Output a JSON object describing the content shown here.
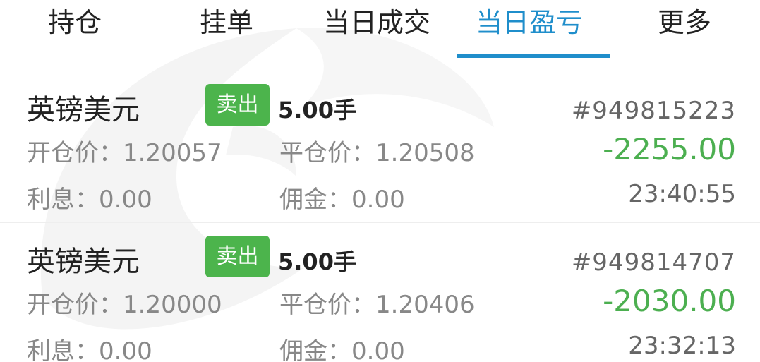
{
  "tabs": [
    {
      "label": "持仓"
    },
    {
      "label": "挂单"
    },
    {
      "label": "当日成交"
    },
    {
      "label": "当日盈亏"
    },
    {
      "label": "更多"
    }
  ],
  "active_tab": "当日盈亏",
  "labels": {
    "open_price": "开仓价：",
    "close_price": "平仓价：",
    "swap": "利息：",
    "commission": "佣金："
  },
  "orders": [
    {
      "symbol": "英镑美元",
      "side": "卖出",
      "lots": "5.00手",
      "order_id": "#949815223",
      "open_price": "1.20057",
      "close_price": "1.20508",
      "profit": "-2255.00",
      "swap": "0.00",
      "commission": "0.00",
      "time": "23:40:55"
    },
    {
      "symbol": "英镑美元",
      "side": "卖出",
      "lots": "5.00手",
      "order_id": "#949814707",
      "open_price": "1.20000",
      "close_price": "1.20406",
      "profit": "-2030.00",
      "swap": "0.00",
      "commission": "0.00",
      "time": "23:32:13"
    }
  ],
  "colors": {
    "accent": "#1f8ecb",
    "sell_badge": "#4cb44c",
    "profit_text": "#4caf50"
  }
}
